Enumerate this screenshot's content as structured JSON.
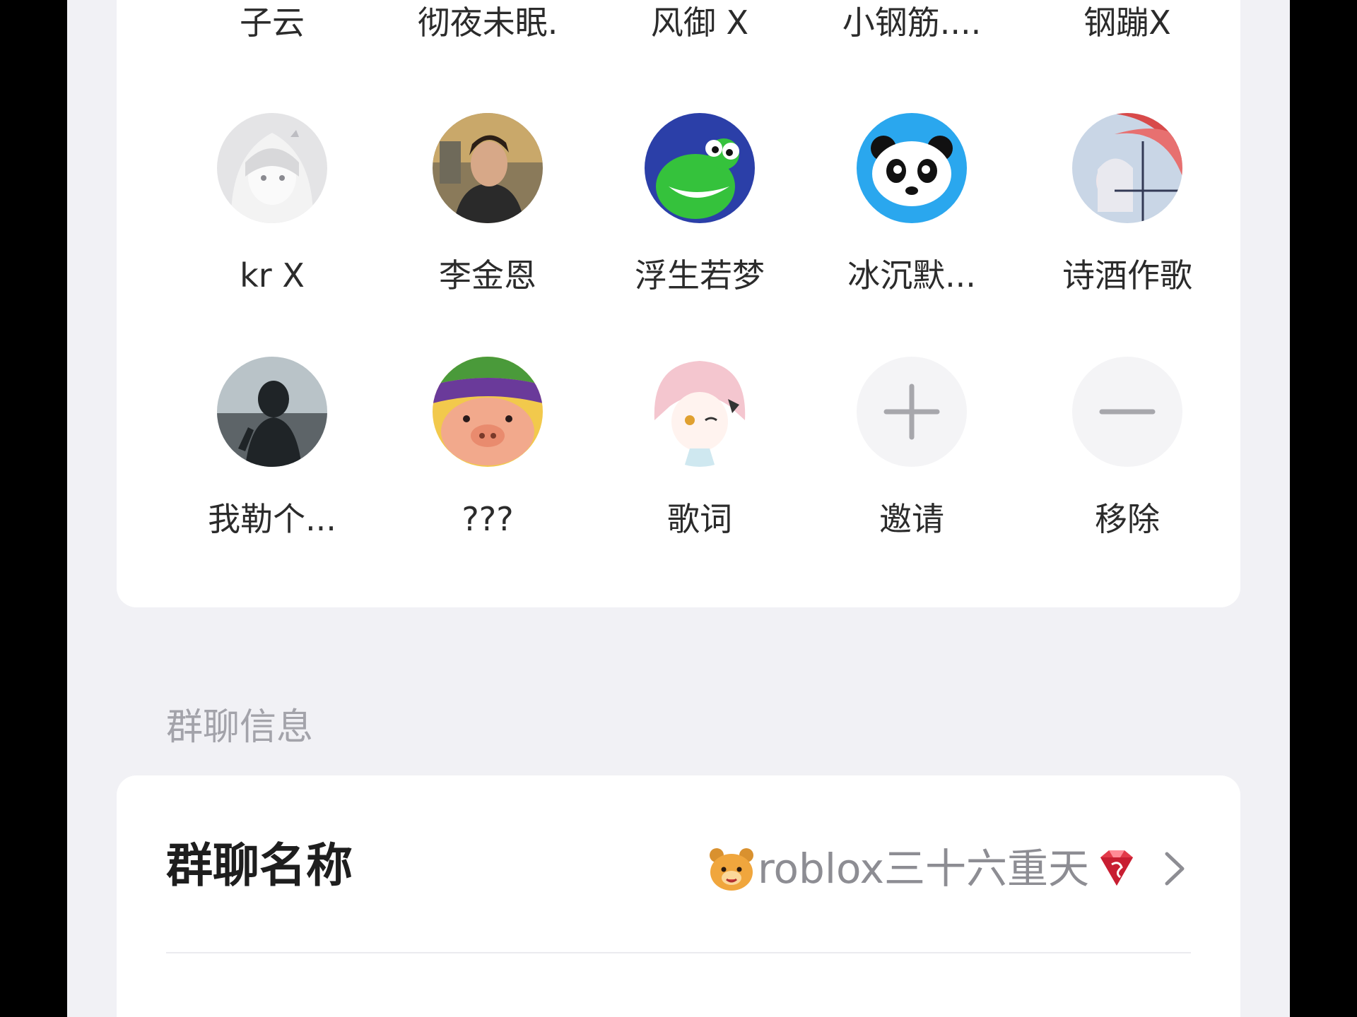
{
  "members": {
    "top_row_names": [
      "子云",
      "彻夜未眠.",
      "风御 X",
      "小钢筋....",
      "钢蹦X"
    ],
    "row1": [
      {
        "name": "kr X",
        "avatar": "anime-girl-avatar"
      },
      {
        "name": "李金恩",
        "avatar": "man-portrait-avatar"
      },
      {
        "name": "浮生若梦",
        "avatar": "green-dinosaur-avatar"
      },
      {
        "name": "冰沉默...",
        "avatar": "panda-avatar"
      },
      {
        "name": "诗酒作歌",
        "avatar": "umbrella-girl-avatar"
      }
    ],
    "row2": [
      {
        "name": "我勒个...",
        "avatar": "silhouette-avatar"
      },
      {
        "name": "???",
        "avatar": "cartoon-pig-avatar"
      },
      {
        "name": "歌词",
        "avatar": "pink-hair-girl-avatar"
      }
    ],
    "actions": {
      "invite_label": "邀请",
      "remove_label": "移除"
    }
  },
  "group_info": {
    "section_title": "群聊信息",
    "name_label": "群聊名称",
    "name_value": "roblox三十六重天"
  },
  "colors": {
    "page_background": "#f1f1f5",
    "card_background": "#ffffff",
    "section_title": "#a3a3aa",
    "value_text": "#8d8d93"
  }
}
